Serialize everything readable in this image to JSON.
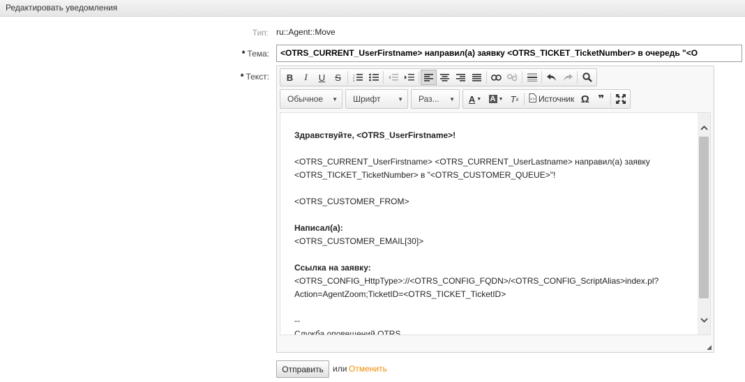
{
  "header": {
    "title": "Редактировать уведомления"
  },
  "form": {
    "type_label": "Тип:",
    "type_value": "ru::Agent::Move",
    "subject_label": "Тема:",
    "subject_value": "<OTRS_CURRENT_UserFirstname> направил(а) заявку <OTRS_TICKET_TicketNumber> в  очередь \"<O",
    "text_label": "Текст:"
  },
  "editor": {
    "format_combo": "Обычное",
    "font_combo": "Шрифт",
    "size_combo": "Раз...",
    "source_label": "Источник",
    "content": {
      "greeting": "Здравствуйте, <OTRS_UserFirstname>!",
      "line1": "<OTRS_CURRENT_UserFirstname> <OTRS_CURRENT_UserLastname> направил(а) заявку",
      "line2": "<OTRS_TICKET_TicketNumber> в \"<OTRS_CUSTOMER_QUEUE>\"!",
      "from": "<OTRS_CUSTOMER_FROM>",
      "wrote_label": "Написал(а):",
      "email": "<OTRS_CUSTOMER_EMAIL[30]>",
      "link_label": "Ссылка на заявку:",
      "link_line1": "<OTRS_CONFIG_HttpType>://<OTRS_CONFIG_FQDN>/<OTRS_CONFIG_ScriptAlias>index.pl?",
      "link_line2": "Action=AgentZoom;TicketID=<OTRS_TICKET_TicketID>",
      "signature_sep": "--",
      "signature": "Служба оповещений OTRS"
    }
  },
  "actions": {
    "submit_label": "Отправить",
    "or_text": "или",
    "cancel_label": "Отменить"
  },
  "colors": {
    "cancel_link": "#f08c00",
    "header_bg": "#eaeaea"
  }
}
